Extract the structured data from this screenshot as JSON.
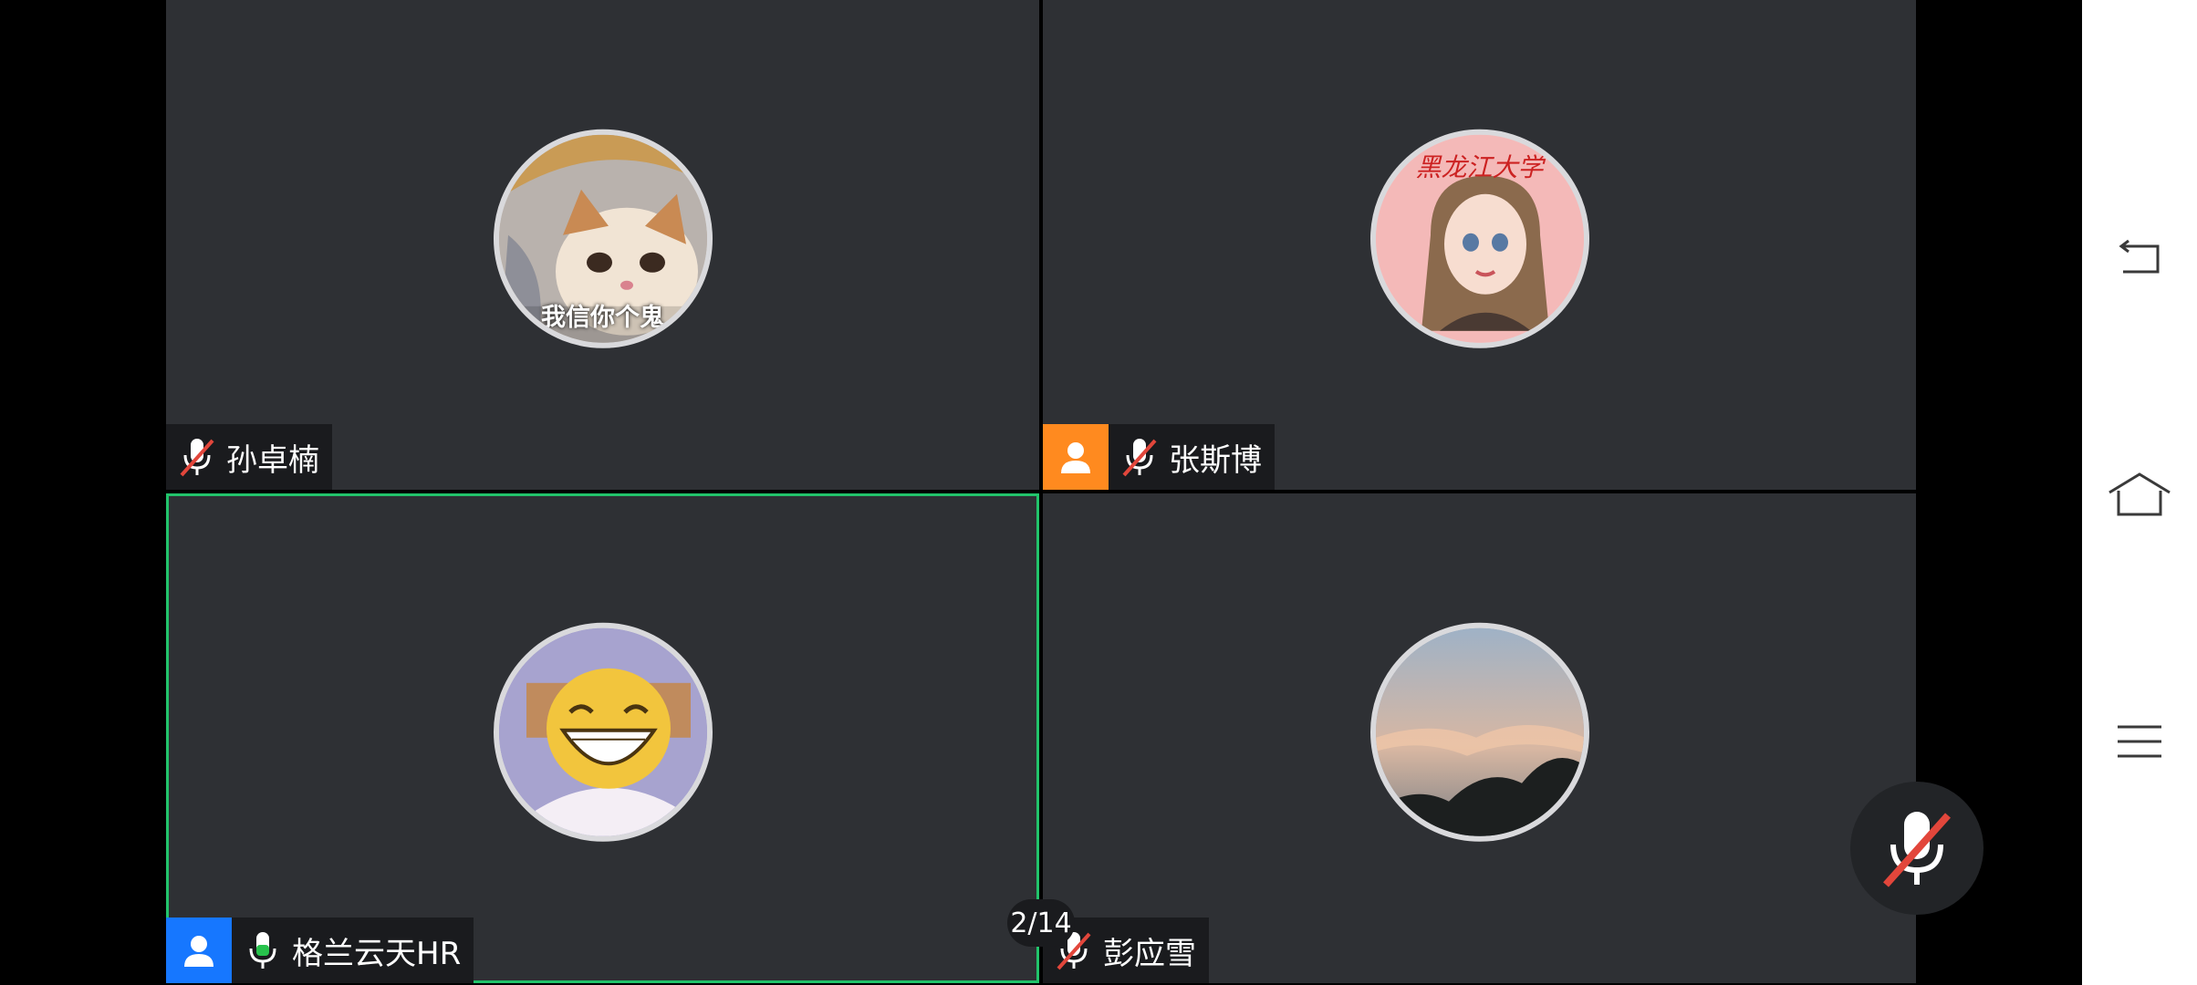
{
  "participants": [
    {
      "name": "孙卓楠",
      "muted": true,
      "role": "none",
      "avatar_caption": "我信你个鬼"
    },
    {
      "name": "张斯博",
      "muted": true,
      "role": "host",
      "avatar_caption": "黑龙江大学"
    },
    {
      "name": "格兰云天HR",
      "muted": false,
      "role": "cohost",
      "active_speaker": true
    },
    {
      "name": "彭应雪",
      "muted": true,
      "role": "none"
    }
  ],
  "pagination": {
    "text": "2/14"
  },
  "colors": {
    "tile_bg": "#2e3034",
    "active_border": "#22c36b",
    "host_badge": "#ff8a1f",
    "cohost_badge": "#1677ff",
    "mute_red": "#e2463b",
    "mic_green": "#27c24c"
  },
  "icons": {
    "nav_back": "back-icon",
    "nav_home": "home-icon",
    "nav_menu": "menu-icon",
    "floating_mic": "mic-muted-icon"
  }
}
